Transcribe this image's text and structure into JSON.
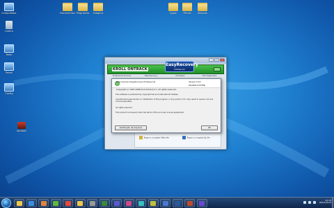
{
  "desktop": {
    "icons": [
      {
        "label": "Computador",
        "kind": "sys"
      },
      {
        "label": "Documentos",
        "kind": "folder"
      },
      {
        "label": "Programas",
        "kind": "folder"
      },
      {
        "label": "Imagens",
        "kind": "folder"
      },
      {
        "label": "Jogos",
        "kind": "folder"
      },
      {
        "label": "Filmes",
        "kind": "folder"
      },
      {
        "label": "Músicas",
        "kind": "folder"
      },
      {
        "label": "Lixeira",
        "kind": "recycle"
      },
      {
        "label": "Rede",
        "kind": "sys"
      },
      {
        "label": "Painel",
        "kind": "sys"
      },
      {
        "label": "Config",
        "kind": "sys"
      },
      {
        "label": "WinRAR",
        "kind": "app"
      }
    ]
  },
  "window": {
    "banner_brand": "KROLL ONTRACK",
    "logo_title": "EasyRecovery",
    "logo_sub": "Professional",
    "tabs": [
      "Professional Services",
      "Data Recovery",
      "File Repair",
      "Disk Diagnostics"
    ],
    "promo": [
      {
        "label": "Repair a corrupted Office file"
      },
      {
        "label": "Repair a corrupted Zip file"
      }
    ],
    "controls": {
      "min": "–",
      "max": "□",
      "close": "x"
    }
  },
  "dialog": {
    "product_line": "Kroll Ontrack EasyRecovery Professional",
    "version_label": "Version 6.10",
    "copyright_line": "Copyright (c) 1997-2006 Kroll Ontrack Inc. All rights reserved.",
    "serial_label": "[DOSEZ-SYSTEM]",
    "body_paragraphs": [
      "This software is protected by copyright law and international treaties.",
      "Unauthorized reproduction or distribution of this program, or any portion of it, may result in severe civil and criminal penalties.",
      "All rights reserved.",
      "This product is licensed under the terms of the end user license agreement."
    ],
    "checkbox_button": "Verificação de Arquivos",
    "ok_button": "OK"
  },
  "taskbar": {
    "time": "22:10",
    "date": "05/01/2012",
    "items": [
      {
        "name": "explorer",
        "color": "#f0c94a"
      },
      {
        "name": "ie",
        "color": "#3b8ee0"
      },
      {
        "name": "media",
        "color": "#e0853b"
      },
      {
        "name": "utorrent",
        "color": "#5dbb3a"
      },
      {
        "name": "chrome",
        "color": "#e84a3a"
      },
      {
        "name": "folder",
        "color": "#f0c94a"
      },
      {
        "name": "app1",
        "color": "#9a9a9a"
      },
      {
        "name": "app2",
        "color": "#3a8a3a"
      },
      {
        "name": "app3",
        "color": "#5a5ad0"
      },
      {
        "name": "app4",
        "color": "#d04a8a"
      },
      {
        "name": "app5",
        "color": "#3ac0c0"
      },
      {
        "name": "app6",
        "color": "#c0c03a"
      },
      {
        "name": "app7",
        "color": "#4a7ad0"
      },
      {
        "name": "app8",
        "color": "#2a5a9a"
      },
      {
        "name": "app9",
        "color": "#c04a2a"
      },
      {
        "name": "app10",
        "color": "#6a4ad0"
      }
    ]
  }
}
